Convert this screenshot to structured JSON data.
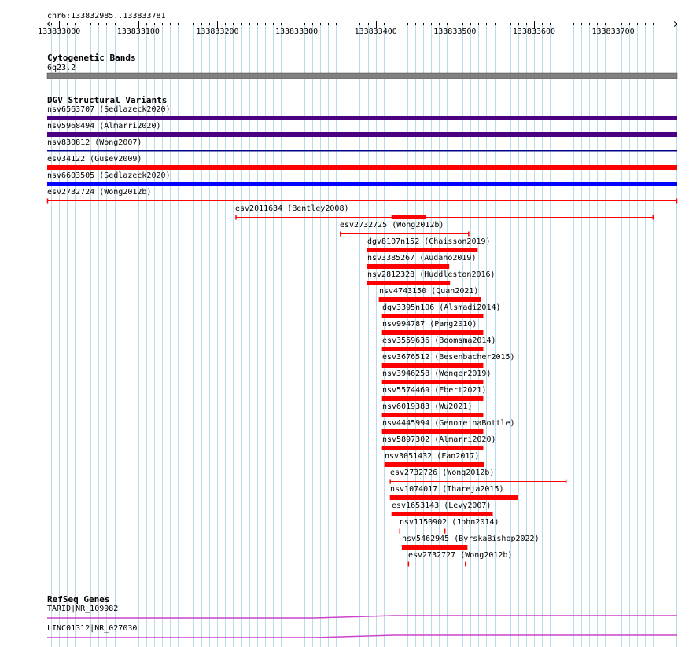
{
  "view": {
    "chrom": "chr6",
    "start": 133832985,
    "end": 133833781,
    "position_label": "chr6:133832985..133833781"
  },
  "ruler": {
    "ticks": [
      "133833000",
      "133833100",
      "133833200",
      "133833300",
      "133833400",
      "133833500",
      "133833600",
      "133833700"
    ]
  },
  "colors": {
    "gridline": "#b9dced",
    "band": "#808080",
    "purple": "#4b0082",
    "navy": "#00008b",
    "red": "#ff0000",
    "blue": "#0000ff",
    "gene": "#cc44cc"
  },
  "tracks": {
    "cytoband": {
      "title": "Cytogenetic Bands",
      "band_label": "6q23.2"
    },
    "dgv": {
      "title": "DGV Structural Variants",
      "features": [
        {
          "label": "nsv6563707 (Sedlazeck2020)",
          "start": 133832985,
          "end": 133833781,
          "color": "purple",
          "style": "bar",
          "row": 0
        },
        {
          "label": "nsv5968494 (Almarri2020)",
          "start": 133832985,
          "end": 133833781,
          "color": "purple",
          "style": "bar",
          "row": 1
        },
        {
          "label": "nsv830812 (Wong2007)",
          "start": 133832985,
          "end": 133833781,
          "color": "navy",
          "style": "thin",
          "row": 2
        },
        {
          "label": "esv34122 (Gusev2009)",
          "start": 133832985,
          "end": 133833781,
          "color": "red",
          "style": "bar",
          "row": 3
        },
        {
          "label": "nsv6603505 (Sedlazeck2020)",
          "start": 133832985,
          "end": 133833781,
          "color": "blue",
          "style": "bar",
          "row": 4
        },
        {
          "label": "esv2732724 (Wong2012b)",
          "start": 133832985,
          "end": 133833781,
          "color": "red",
          "style": "range",
          "row": 5
        },
        {
          "label": "esv2011634 (Bentley2008)",
          "start": 133833223,
          "end": 133833751,
          "color": "red",
          "style": "range",
          "inner_start": 133833420,
          "inner_end": 133833463,
          "row": 6
        },
        {
          "label": "esv2732725 (Wong2012b)",
          "start": 133833355,
          "end": 133833518,
          "color": "red",
          "style": "range",
          "row": 7
        },
        {
          "label": "dgv8107n152 (Chaisson2019)",
          "start": 133833389,
          "end": 133833529,
          "color": "red",
          "style": "bar",
          "row": 8
        },
        {
          "label": "nsv3385267 (Audano2019)",
          "start": 133833389,
          "end": 133833493,
          "color": "red",
          "style": "bar",
          "row": 9
        },
        {
          "label": "nsv2812328 (Huddleston2016)",
          "start": 133833389,
          "end": 133833494,
          "color": "red",
          "style": "bar",
          "row": 10
        },
        {
          "label": "nsv4743150 (Quan2021)",
          "start": 133833404,
          "end": 133833533,
          "color": "red",
          "style": "bar",
          "row": 11
        },
        {
          "label": "dgv3395n106 (Alsmadi2014)",
          "start": 133833408,
          "end": 133833536,
          "color": "red",
          "style": "bar",
          "row": 12
        },
        {
          "label": "nsv994787 (Pang2010)",
          "start": 133833408,
          "end": 133833536,
          "color": "red",
          "style": "bar",
          "row": 13
        },
        {
          "label": "esv3559636 (Boomsma2014)",
          "start": 133833408,
          "end": 133833536,
          "color": "red",
          "style": "bar",
          "row": 14
        },
        {
          "label": "esv3676512 (Besenbacher2015)",
          "start": 133833408,
          "end": 133833536,
          "color": "red",
          "style": "bar",
          "row": 15
        },
        {
          "label": "nsv3946258 (Wenger2019)",
          "start": 133833408,
          "end": 133833536,
          "color": "red",
          "style": "bar",
          "row": 16
        },
        {
          "label": "nsv5574469 (Ebert2021)",
          "start": 133833408,
          "end": 133833536,
          "color": "red",
          "style": "bar",
          "row": 17
        },
        {
          "label": "nsv6019383 (Wu2021)",
          "start": 133833408,
          "end": 133833536,
          "color": "red",
          "style": "bar",
          "row": 18
        },
        {
          "label": "nsv4445994 (GenomeinaBottle)",
          "start": 133833408,
          "end": 133833536,
          "color": "red",
          "style": "bar",
          "row": 19
        },
        {
          "label": "nsv5897302 (Almarri2020)",
          "start": 133833408,
          "end": 133833536,
          "color": "red",
          "style": "bar",
          "row": 20
        },
        {
          "label": "nsv3051432 (Fan2017)",
          "start": 133833411,
          "end": 133833537,
          "color": "red",
          "style": "bar",
          "row": 21
        },
        {
          "label": "esv2732726 (Wong2012b)",
          "start": 133833418,
          "end": 133833641,
          "color": "red",
          "style": "range",
          "row": 22
        },
        {
          "label": "nsv1074017 (Thareja2015)",
          "start": 133833418,
          "end": 133833580,
          "color": "red",
          "style": "bar",
          "row": 23
        },
        {
          "label": "esv1653143 (Levy2007)",
          "start": 133833420,
          "end": 133833548,
          "color": "red",
          "style": "bar",
          "row": 24
        },
        {
          "label": "nsv1150902 (John2014)",
          "start": 133833430,
          "end": 133833488,
          "color": "red",
          "style": "range",
          "row": 25
        },
        {
          "label": "nsv5462945 (ByrskaBishop2022)",
          "start": 133833433,
          "end": 133833516,
          "color": "red",
          "style": "bar",
          "row": 26
        },
        {
          "label": "esv2732727 (Wong2012b)",
          "start": 133833441,
          "end": 133833514,
          "color": "red",
          "style": "range",
          "row": 27
        }
      ]
    },
    "refseq": {
      "title": "RefSeq Genes",
      "genes": [
        {
          "label": "TARID|NR_109982",
          "start": 133832985,
          "end": 133833781,
          "row": 0
        },
        {
          "label": "LINC01312|NR_027030",
          "start": 133832985,
          "end": 133833781,
          "row": 1
        }
      ]
    }
  }
}
